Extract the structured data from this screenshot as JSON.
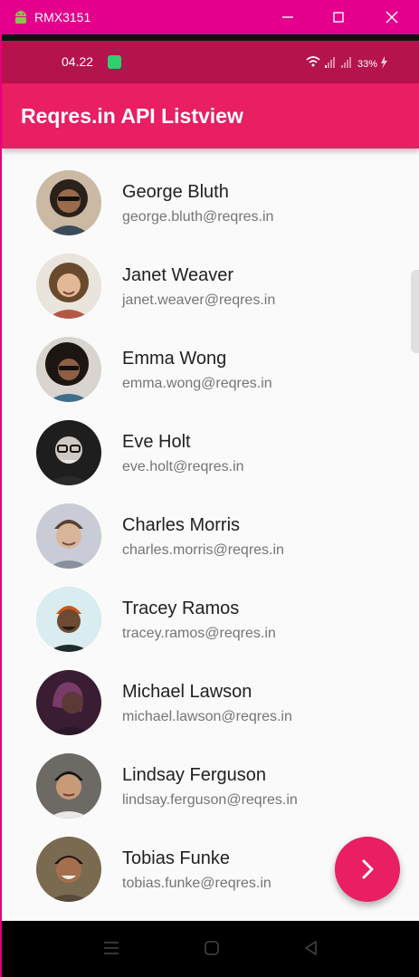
{
  "window": {
    "title": "RMX3151"
  },
  "status_bar": {
    "time": "04.22",
    "battery": "33%"
  },
  "appbar": {
    "title": "Reqres.in API Listview"
  },
  "users": [
    {
      "name": "George Bluth",
      "email": "george.bluth@reqres.in"
    },
    {
      "name": "Janet Weaver",
      "email": "janet.weaver@reqres.in"
    },
    {
      "name": "Emma Wong",
      "email": "emma.wong@reqres.in"
    },
    {
      "name": "Eve Holt",
      "email": "eve.holt@reqres.in"
    },
    {
      "name": "Charles Morris",
      "email": "charles.morris@reqres.in"
    },
    {
      "name": "Tracey Ramos",
      "email": "tracey.ramos@reqres.in"
    },
    {
      "name": "Michael Lawson",
      "email": "michael.lawson@reqres.in"
    },
    {
      "name": "Lindsay Ferguson",
      "email": "lindsay.ferguson@reqres.in"
    },
    {
      "name": "Tobias Funke",
      "email": "tobias.funke@reqres.in"
    }
  ],
  "fab": {
    "icon": "chevron-right-icon"
  },
  "nav": {
    "icons": [
      "menu-icon",
      "home-icon",
      "back-icon"
    ]
  },
  "colors": {
    "primary": "#e91e63",
    "status_bar": "#b5134d",
    "window_title": "#e4008c"
  }
}
